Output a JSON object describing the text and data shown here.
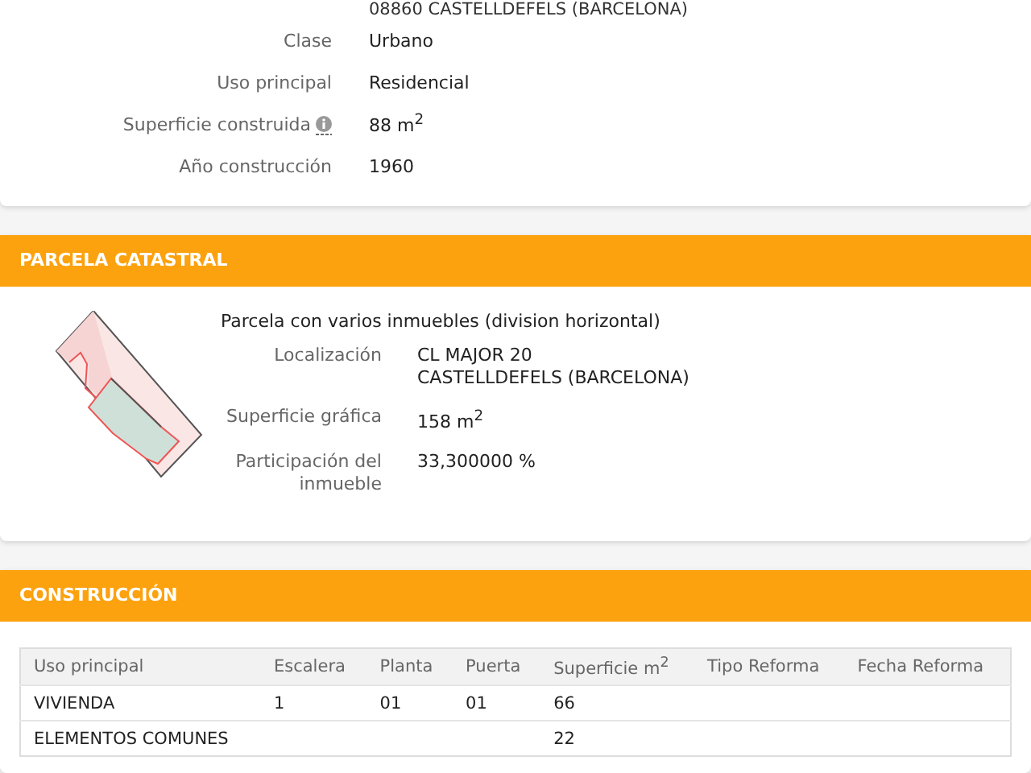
{
  "inmueble": {
    "address_line": "08860 CASTELLDEFELS (BARCELONA)",
    "fields": [
      {
        "label": "Clase",
        "value": "Urbano",
        "info": false
      },
      {
        "label": "Uso principal",
        "value": "Residencial",
        "info": false
      },
      {
        "label": "Superficie construida",
        "value": "88 m$^{2}$",
        "info": true
      },
      {
        "label": "Año construcción",
        "value": "1960",
        "info": false
      }
    ]
  },
  "parcela": {
    "title": "PARCELA CATASTRAL",
    "description": "Parcela con varios inmuebles (division horizontal)",
    "fields": [
      {
        "label": "Localización",
        "value_lines": [
          "CL MAJOR 20",
          "CASTELLDEFELS (BARCELONA)"
        ]
      },
      {
        "label": "Superficie gráfica",
        "value_lines": [
          "158 m$^{2}$"
        ]
      },
      {
        "label": "Participación del inmueble",
        "value_lines": [
          "33,300000 %"
        ]
      }
    ]
  },
  "construccion": {
    "title": "CONSTRUCCIÓN",
    "table": {
      "columns": [
        "Uso principal",
        "Escalera",
        "Planta",
        "Puerta",
        "Superficie m$^{2}$",
        "Tipo Reforma",
        "Fecha Reforma"
      ],
      "rows": [
        [
          "VIVIENDA",
          "1",
          "01",
          "01",
          "66",
          "",
          ""
        ],
        [
          "ELEMENTOS COMUNES",
          "",
          "",
          "",
          "22",
          "",
          ""
        ]
      ]
    }
  }
}
